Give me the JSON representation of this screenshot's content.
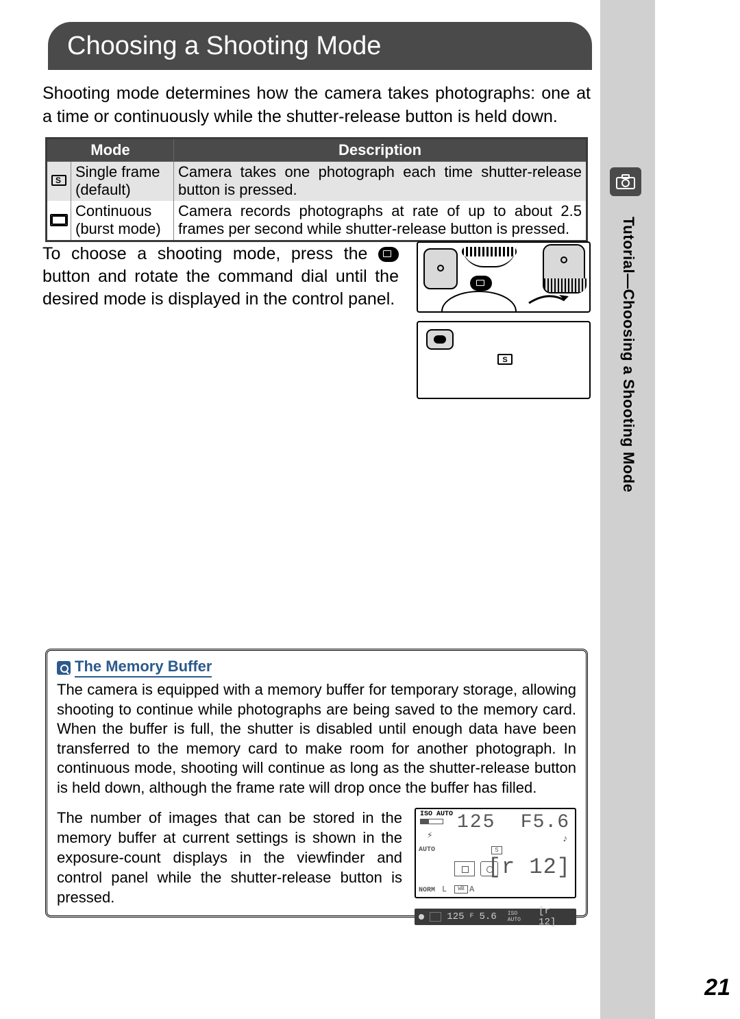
{
  "header": {
    "title": "Choosing a Shooting Mode"
  },
  "intro": "Shooting mode determines how the camera takes photographs: one at a time or continuously while the shutter-release button is held down.",
  "table": {
    "headers": {
      "mode": "Mode",
      "desc": "Description"
    },
    "rows": [
      {
        "mode_line1": "Single frame",
        "mode_line2": "(default)",
        "desc": "Camera takes one photograph each time shutter-release button is pressed."
      },
      {
        "mode_line1": "Continuous",
        "mode_line2": "(burst mode)",
        "desc": "Camera records photographs at rate of up to about 2.5 frames per second while shutter-release button is pressed."
      }
    ]
  },
  "instruction": {
    "before": "To choose a shooting mode, press the ",
    "after": " button and rotate the command dial until the desired mode is displayed in the control panel."
  },
  "diagram": {
    "s_indicator": "S"
  },
  "note": {
    "title": "The Memory Buffer",
    "p1": "The camera is equipped with a memory buffer for temporary storage, allowing shooting to continue while photographs are being saved to the memory card. When the buffer is full, the shutter is disabled until enough data have been trans­ferred to the memory card to make room for another photograph.  In continuous mode, shooting will continue as long as the shutter-release button is held down, although the frame rate will drop once the buffer has filled.",
    "p2": "The number of images that can be stored in the memory buffer at current settings is shown in the exposure-count displays in the viewfinder and control panel while the shutter-release button is pressed."
  },
  "lcd": {
    "iso": "ISO AUTO",
    "shutter": "125",
    "aperture": "F5.6",
    "flash": "⚡",
    "note_symbol": "♪",
    "auto": "AUTO",
    "s_box": "S",
    "count": "[r 12]",
    "norm": "NORM",
    "size": "L",
    "wb": "WB",
    "wb_mode": "A"
  },
  "viewfinder": {
    "shutter": "125",
    "aperture_prefix": "F",
    "aperture": "5.6",
    "iso": "ISO AUTO",
    "count": "[r 12]"
  },
  "sidebar": {
    "text": "Tutorial—Choosing a Shooting Mode"
  },
  "page_number": "21"
}
